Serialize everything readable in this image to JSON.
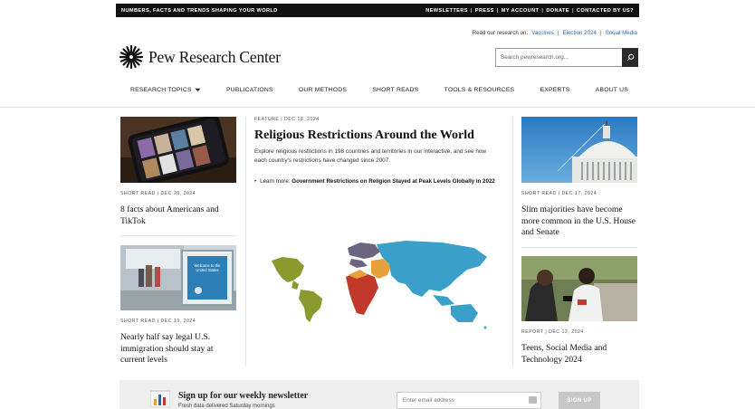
{
  "topbar": {
    "tagline": "NUMBERS, FACTS AND TRENDS SHAPING YOUR WORLD",
    "links": [
      "NEWSLETTERS",
      "PRESS",
      "MY ACCOUNT",
      "DONATE",
      "CONTACTED BY US?"
    ]
  },
  "read_on": {
    "prefix": "Read our research on:",
    "topics": [
      "Vaccines",
      "Election 2024",
      "Social Media"
    ],
    "separator": "|"
  },
  "logo": {
    "text": "Pew Research Center"
  },
  "search": {
    "placeholder": "Search pewresearch.org..."
  },
  "nav": {
    "items": [
      "RESEARCH TOPICS",
      "PUBLICATIONS",
      "OUR METHODS",
      "SHORT READS",
      "TOOLS & RESOURCES",
      "EXPERTS",
      "ABOUT US"
    ]
  },
  "left_col": {
    "card1": {
      "kicker": "SHORT READ | DEC 20, 2024",
      "title": "8 facts about Americans and TikTok"
    },
    "card2": {
      "kicker": "SHORT READ | DEC 19, 2024",
      "title": "Nearly half say legal U.S. immigration should stay at current levels",
      "sign_text": "Welcome to the United States"
    }
  },
  "feature": {
    "kicker": "FEATURE | DEC 18, 2024",
    "title": "Religious Restrictions Around the World",
    "description": "Explore religious restrictions in 198 countries and territories in our interactive, and see how each country's restrictions have changed since 2007.",
    "bullet_prefix": "Learn more:",
    "bullet_link": "Government Restrictions on Religion Stayed at Peak Levels Globally in 2022"
  },
  "right_col": {
    "card1": {
      "kicker": "SHORT READ | DEC 17, 2024",
      "title": "Slim majorities have become more common in the U.S. House and Senate"
    },
    "card2": {
      "kicker": "REPORT | DEC 12, 2024",
      "title": "Teens, Social Media and Technology 2024"
    }
  },
  "newsletter": {
    "title": "Sign up for our weekly newsletter",
    "subtitle": "Fresh data delivered Saturday mornings",
    "placeholder": "Enter email address",
    "button": "SIGN UP"
  },
  "colors": {
    "topbar": "#111111",
    "link": "#2a66b8",
    "map_olive": "#8a9a2e",
    "map_red": "#c0392b",
    "map_orange": "#e8a13a",
    "map_blue": "#3aa0c9",
    "map_purple": "#6b6582"
  }
}
